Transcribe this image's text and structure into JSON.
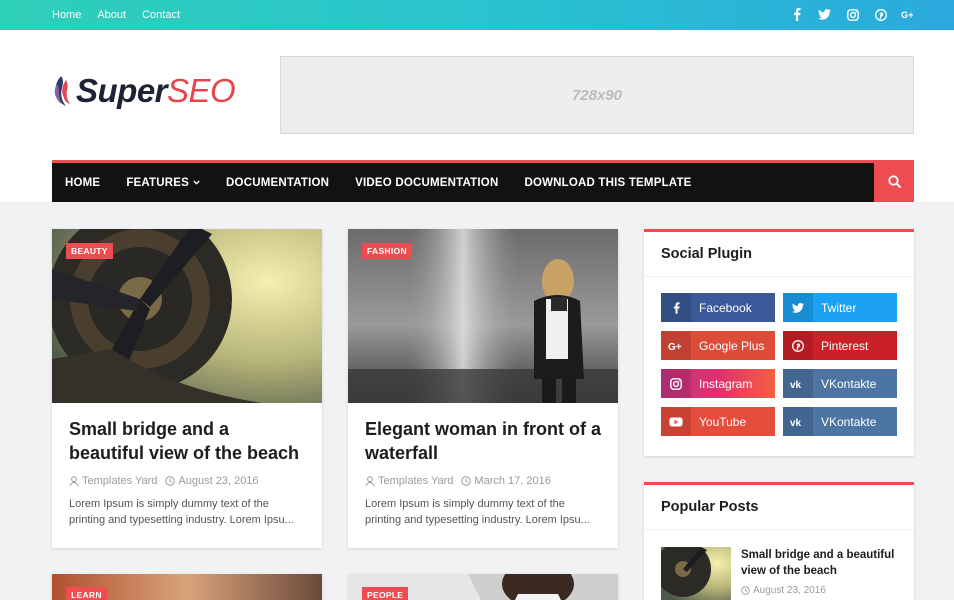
{
  "topbar": {
    "nav": [
      "Home",
      "About",
      "Contact"
    ],
    "social_icons": [
      "facebook-icon",
      "twitter-icon",
      "instagram-icon",
      "pinterest-icon",
      "google-plus-icon"
    ]
  },
  "header": {
    "logo_part1": "Super",
    "logo_part2": "SEO",
    "ad_text": "728x90"
  },
  "mainnav": {
    "items": [
      "HOME",
      "FEATURES",
      "DOCUMENTATION",
      "VIDEO DOCUMENTATION",
      "DOWNLOAD THIS TEMPLATE"
    ]
  },
  "posts": [
    {
      "label": "BEAUTY",
      "title": "Small bridge and a beautiful view of the beach",
      "author": "Templates Yard",
      "date": "August 23, 2016",
      "excerpt": "Lorem Ipsum is simply dummy text of the printing and typesetting industry. Lorem Ipsu..."
    },
    {
      "label": "FASHION",
      "title": "Elegant woman in front of a waterfall",
      "author": "Templates Yard",
      "date": "March 17, 2016",
      "excerpt": "Lorem Ipsum is simply dummy text of the printing and typesetting industry. Lorem Ipsu..."
    },
    {
      "label": "LEARN"
    },
    {
      "label": "PEOPLE"
    }
  ],
  "sidebar": {
    "social_title": "Social Plugin",
    "social_buttons": [
      {
        "label": "Facebook",
        "color": "#3b5998",
        "icon": "facebook-icon"
      },
      {
        "label": "Twitter",
        "color": "#1da1f2",
        "icon": "twitter-icon"
      },
      {
        "label": "Google Plus",
        "color": "#dd4b39",
        "icon": "google-plus-icon"
      },
      {
        "label": "Pinterest",
        "color": "#cb2027",
        "icon": "pinterest-icon"
      },
      {
        "label": "Instagram",
        "color": "#c13584",
        "icon": "instagram-icon"
      },
      {
        "label": "VKontakte",
        "color": "#4c75a3",
        "icon": "vk-icon"
      },
      {
        "label": "YouTube",
        "color": "#e44c3c",
        "icon": "youtube-icon"
      },
      {
        "label": "VKontakte",
        "color": "#4c75a3",
        "icon": "vk-icon"
      }
    ],
    "popular_title": "Popular Posts",
    "popular_items": [
      {
        "title": "Small bridge and a beautiful view of the beach",
        "date": "August 23, 2016"
      }
    ]
  },
  "colors": {
    "accent": "#ef4c51",
    "nav_bg": "#121212",
    "topbar_from": "#2ecfb8",
    "topbar_to": "#2aa9dd"
  }
}
